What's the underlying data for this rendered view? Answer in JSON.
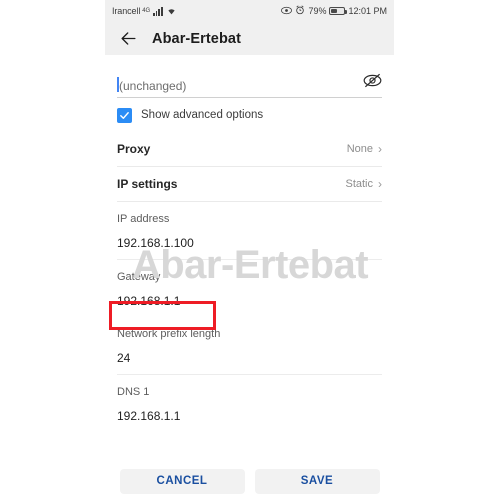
{
  "status_bar": {
    "carrier": "Irancell",
    "network_type": "4G",
    "signal_icon": "signal-bars-icon",
    "wifi_icon": "wifi-icon",
    "eye_icon": "eye-icon",
    "alarm_icon": "alarm-clock-icon",
    "battery_percent": "79%",
    "battery_icon": "battery-icon",
    "time": "12:01 PM"
  },
  "app_bar": {
    "back_icon": "back-arrow-icon",
    "title": "Abar-Ertebat"
  },
  "password_field": {
    "value": "(unchanged)",
    "placeholder": "(unchanged)",
    "toggle_icon": "eye-off-icon"
  },
  "advanced_checkbox": {
    "label": "Show advanced options",
    "checked": true,
    "check_icon": "checkmark-icon"
  },
  "settings_rows": [
    {
      "label": "Proxy",
      "value": "None",
      "chevron": "chevron-right-icon"
    },
    {
      "label": "IP settings",
      "value": "Static",
      "chevron": "chevron-right-icon"
    }
  ],
  "fields": [
    {
      "label": "IP address",
      "value": "192.168.1.100"
    },
    {
      "label": "Gateway",
      "value": "192.168.1.1"
    },
    {
      "label": "Network prefix length",
      "value": "24"
    },
    {
      "label": "DNS 1",
      "value": "192.168.1.1"
    }
  ],
  "watermark": "Abar-Ertebat",
  "buttons": {
    "cancel": "CANCEL",
    "save": "SAVE"
  },
  "colors": {
    "accent_blue": "#2b8cf5",
    "button_text": "#1a4fa0",
    "highlight_red": "#ee1c25",
    "bar_gray": "#f0f0f0",
    "watermark_gray": "#d7d7d7"
  }
}
